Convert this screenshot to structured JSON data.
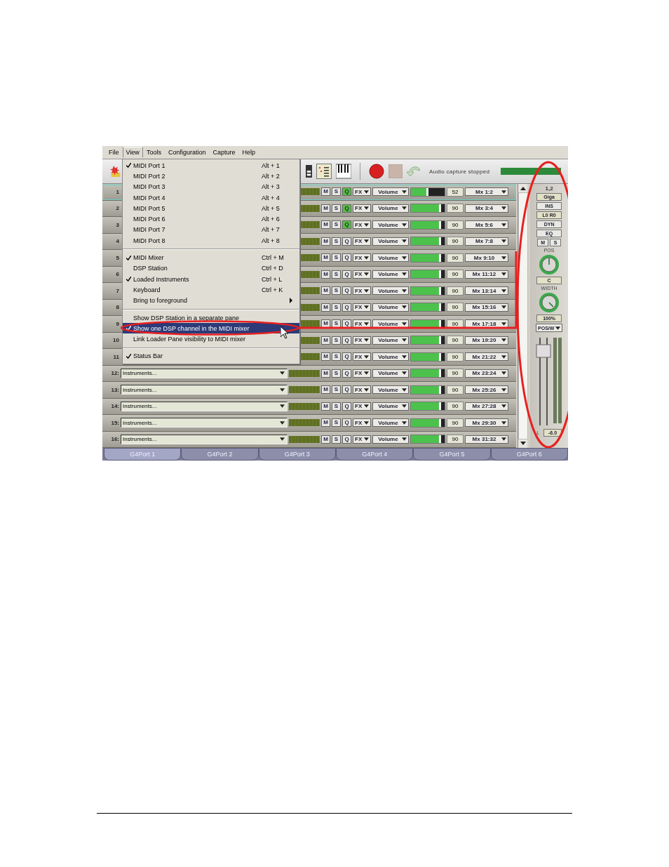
{
  "menubar": [
    {
      "label": "File",
      "selected": false
    },
    {
      "label": "View",
      "selected": true
    },
    {
      "label": "Tools",
      "selected": false
    },
    {
      "label": "Configuration",
      "selected": false
    },
    {
      "label": "Capture",
      "selected": false
    },
    {
      "label": "Help",
      "selected": false
    }
  ],
  "toolbar": {
    "status": "Audio capture stopped"
  },
  "view_menu": [
    {
      "kind": "item",
      "label": "MIDI Port 1",
      "shortcut": "Alt + 1",
      "checked": true,
      "submenu": false,
      "selected": false
    },
    {
      "kind": "item",
      "label": "MIDI Port 2",
      "shortcut": "Alt + 2",
      "checked": false,
      "submenu": false,
      "selected": false
    },
    {
      "kind": "item",
      "label": "MIDI Port 3",
      "shortcut": "Alt + 3",
      "checked": false,
      "submenu": false,
      "selected": false
    },
    {
      "kind": "item",
      "label": "MIDI Port 4",
      "shortcut": "Alt + 4",
      "checked": false,
      "submenu": false,
      "selected": false
    },
    {
      "kind": "item",
      "label": "MIDI Port 5",
      "shortcut": "Alt + 5",
      "checked": false,
      "submenu": false,
      "selected": false
    },
    {
      "kind": "item",
      "label": "MIDI Port 6",
      "shortcut": "Alt + 6",
      "checked": false,
      "submenu": false,
      "selected": false
    },
    {
      "kind": "item",
      "label": "MIDI Port 7",
      "shortcut": "Alt + 7",
      "checked": false,
      "submenu": false,
      "selected": false
    },
    {
      "kind": "item",
      "label": "MIDI Port 8",
      "shortcut": "Alt + 8",
      "checked": false,
      "submenu": false,
      "selected": false
    },
    {
      "kind": "separator"
    },
    {
      "kind": "item",
      "label": "MIDI Mixer",
      "shortcut": "Ctrl + M",
      "checked": true,
      "submenu": false,
      "selected": false
    },
    {
      "kind": "item",
      "label": "DSP Station",
      "shortcut": "Ctrl + D",
      "checked": false,
      "submenu": false,
      "selected": false
    },
    {
      "kind": "item",
      "label": "Loaded Instruments",
      "shortcut": "Ctrl + L",
      "checked": true,
      "submenu": false,
      "selected": false
    },
    {
      "kind": "item",
      "label": "Keyboard",
      "shortcut": "Ctrl + K",
      "checked": false,
      "submenu": false,
      "selected": false
    },
    {
      "kind": "item",
      "label": "Bring to foreground",
      "checked": false,
      "submenu": true,
      "selected": false
    },
    {
      "kind": "separator"
    },
    {
      "kind": "item",
      "label": "Show DSP Station in a separate pane",
      "checked": false,
      "submenu": false,
      "selected": false
    },
    {
      "kind": "item",
      "label": "Show one DSP channel in the MIDI mixer",
      "checked": true,
      "submenu": false,
      "selected": true
    },
    {
      "kind": "item",
      "label": "Link Loader Pane visibility to MIDI mixer",
      "checked": false,
      "submenu": false,
      "selected": false
    },
    {
      "kind": "separator"
    },
    {
      "kind": "item",
      "label": "Status Bar",
      "checked": true,
      "submenu": false,
      "selected": false
    }
  ],
  "channels": [
    {
      "number": "1",
      "selected": true,
      "m": "M",
      "s": "S",
      "q": "Q",
      "q_on": true,
      "fx": "FX",
      "control": "Volume",
      "level": 0.52,
      "value": "52",
      "output": "Mx 1:2"
    },
    {
      "number": "2",
      "selected": false,
      "m": "M",
      "s": "S",
      "q": "Q",
      "q_on": true,
      "fx": "FX",
      "control": "Volume",
      "level": 0.9,
      "value": "90",
      "output": "Mx 3:4"
    },
    {
      "number": "3",
      "selected": false,
      "m": "M",
      "s": "S",
      "q": "Q",
      "q_on": true,
      "fx": "FX",
      "control": "Volume",
      "level": 0.9,
      "value": "90",
      "output": "Mx 5:6"
    },
    {
      "number": "4",
      "selected": false,
      "m": "M",
      "s": "S",
      "q": "Q",
      "q_on": false,
      "fx": "FX",
      "control": "Volume",
      "level": 0.9,
      "value": "90",
      "output": "Mx 7:8"
    },
    {
      "number": "5",
      "selected": false,
      "m": "M",
      "s": "S",
      "q": "Q",
      "q_on": false,
      "fx": "FX",
      "control": "Volume",
      "level": 0.9,
      "value": "90",
      "output": "Mx 9:10"
    },
    {
      "number": "6",
      "selected": false,
      "m": "M",
      "s": "S",
      "q": "Q",
      "q_on": false,
      "fx": "FX",
      "control": "Volume",
      "level": 0.9,
      "value": "90",
      "output": "Mx 11:12"
    },
    {
      "number": "7",
      "selected": false,
      "m": "M",
      "s": "S",
      "q": "Q",
      "q_on": false,
      "fx": "FX",
      "control": "Volume",
      "level": 0.9,
      "value": "90",
      "output": "Mx 13:14"
    },
    {
      "number": "8",
      "selected": false,
      "m": "M",
      "s": "S",
      "q": "Q",
      "q_on": false,
      "fx": "FX",
      "control": "Volume",
      "level": 0.9,
      "value": "90",
      "output": "Mx 15:16"
    },
    {
      "number": "9",
      "selected": false,
      "m": "M",
      "s": "S",
      "q": "Q",
      "q_on": false,
      "fx": "FX",
      "control": "Volume",
      "level": 0.9,
      "value": "90",
      "output": "Mx 17:18"
    },
    {
      "number": "10",
      "selected": false,
      "m": "M",
      "s": "S",
      "q": "Q",
      "q_on": false,
      "fx": "FX",
      "control": "Volume",
      "level": 0.9,
      "value": "90",
      "output": "Mx 19:20"
    },
    {
      "number": "11",
      "selected": false,
      "m": "M",
      "s": "S",
      "q": "Q",
      "q_on": false,
      "fx": "FX",
      "control": "Volume",
      "level": 0.9,
      "value": "90",
      "output": "Mx 21:22"
    },
    {
      "number": "12:",
      "instrument": "Instruments...",
      "selected": false,
      "m": "M",
      "s": "S",
      "q": "Q",
      "q_on": false,
      "fx": "FX",
      "control": "Volume",
      "level": 0.9,
      "value": "90",
      "output": "Mx 23:24"
    },
    {
      "number": "13:",
      "instrument": "Instruments...",
      "selected": false,
      "m": "M",
      "s": "S",
      "q": "Q",
      "q_on": false,
      "fx": "FX",
      "control": "Volume",
      "level": 0.9,
      "value": "90",
      "output": "Mx 25:26"
    },
    {
      "number": "14:",
      "instrument": "Instruments...",
      "selected": false,
      "m": "M",
      "s": "S",
      "q": "Q",
      "q_on": false,
      "fx": "FX",
      "control": "Volume",
      "level": 0.9,
      "value": "90",
      "output": "Mx 27:28"
    },
    {
      "number": "15:",
      "instrument": "Instruments...",
      "selected": false,
      "m": "M",
      "s": "S",
      "q": "Q",
      "q_on": false,
      "fx": "FX",
      "control": "Volume",
      "level": 0.9,
      "value": "90",
      "output": "Mx 29:30"
    },
    {
      "number": "16:",
      "instrument": "Instruments...",
      "selected": false,
      "m": "M",
      "s": "S",
      "q": "Q",
      "q_on": false,
      "fx": "FX",
      "control": "Volume",
      "level": 0.9,
      "value": "90",
      "output": "Mx 31:32"
    }
  ],
  "dsp_channel": {
    "channel": "1,2",
    "slots": [
      {
        "kind": "display",
        "label": "Giga"
      },
      {
        "kind": "button",
        "label": "INS"
      },
      {
        "kind": "display",
        "label": "L0 R0"
      },
      {
        "kind": "button",
        "label": "DYN"
      },
      {
        "kind": "button",
        "label": "EQ"
      }
    ],
    "mute": "M",
    "solo": "S",
    "pos_label": "POS",
    "pos_value": "C",
    "width_label": "WIDTH",
    "width_value": "100%",
    "mode": "POS/W",
    "side": "L",
    "gain": "-6.0"
  },
  "tabs": [
    {
      "label": "G4Port 1",
      "selected": true
    },
    {
      "label": "G4Port 2",
      "selected": false
    },
    {
      "label": "G4Port 3",
      "selected": false
    },
    {
      "label": "G4Port 4",
      "selected": false
    },
    {
      "label": "G4Port 5",
      "selected": false
    },
    {
      "label": "G4Port 6",
      "selected": false
    }
  ]
}
